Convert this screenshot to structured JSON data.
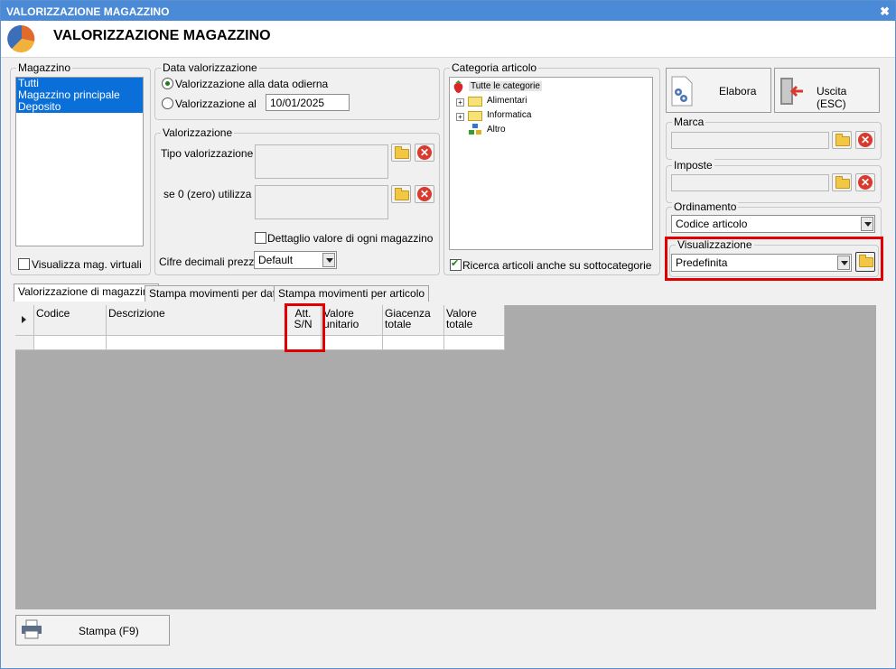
{
  "window": {
    "title": "VALORIZZAZIONE MAGAZZINO",
    "header_title": "VALORIZZAZIONE MAGAZZINO",
    "close_glyph": "✖"
  },
  "magazzino": {
    "caption": "Magazzino",
    "items": [
      "Tutti",
      "Magazzino principale",
      "Deposito"
    ],
    "virtual_checkbox_label": "Visualizza mag. virtuali",
    "virtual_checked": false
  },
  "data_valorizzazione": {
    "caption": "Data valorizzazione",
    "option_today": "Valorizzazione alla data odierna",
    "option_date": "Valorizzazione al",
    "date_value": "10/01/2025",
    "selected": "today"
  },
  "valorizzazione": {
    "caption": "Valorizzazione",
    "tipo_label": "Tipo valorizzazione :",
    "zero_label": "se 0 (zero) utilizza :",
    "dettaglio_label": "Dettaglio valore di ogni magazzino",
    "dettaglio_checked": false,
    "cifre_label": "Cifre decimali prezzi :",
    "cifre_value": "Default"
  },
  "categoria": {
    "caption": "Categoria articolo",
    "root": "Tutte le categorie",
    "children": [
      "Alimentari",
      "Informatica",
      "Altro"
    ],
    "ricerca_label": "Ricerca articoli anche su sottocategorie",
    "ricerca_checked": true
  },
  "buttons": {
    "elabora": "Elabora",
    "uscita": "Uscita (ESC)",
    "stampa": "Stampa (F9)"
  },
  "marca": {
    "caption": "Marca",
    "value": ""
  },
  "imposte": {
    "caption": "Imposte",
    "value": ""
  },
  "ordinamento": {
    "caption": "Ordinamento",
    "value": "Codice articolo"
  },
  "visualizzazione": {
    "caption": "Visualizzazione",
    "value": "Predefinita"
  },
  "tabs": [
    "Valorizzazione di magazzino",
    "Stampa movimenti per data",
    "Stampa movimenti per articolo"
  ],
  "grid": {
    "columns": [
      "Codice",
      "Descrizione",
      "Att. S/N",
      "Valore unitario",
      "Giacenza totale",
      "Valore totale"
    ]
  },
  "colors": {
    "title_bar": "#4a8ad6",
    "selection": "#0a6fd8",
    "highlight": "#e00000",
    "grid_background": "#ababab"
  }
}
